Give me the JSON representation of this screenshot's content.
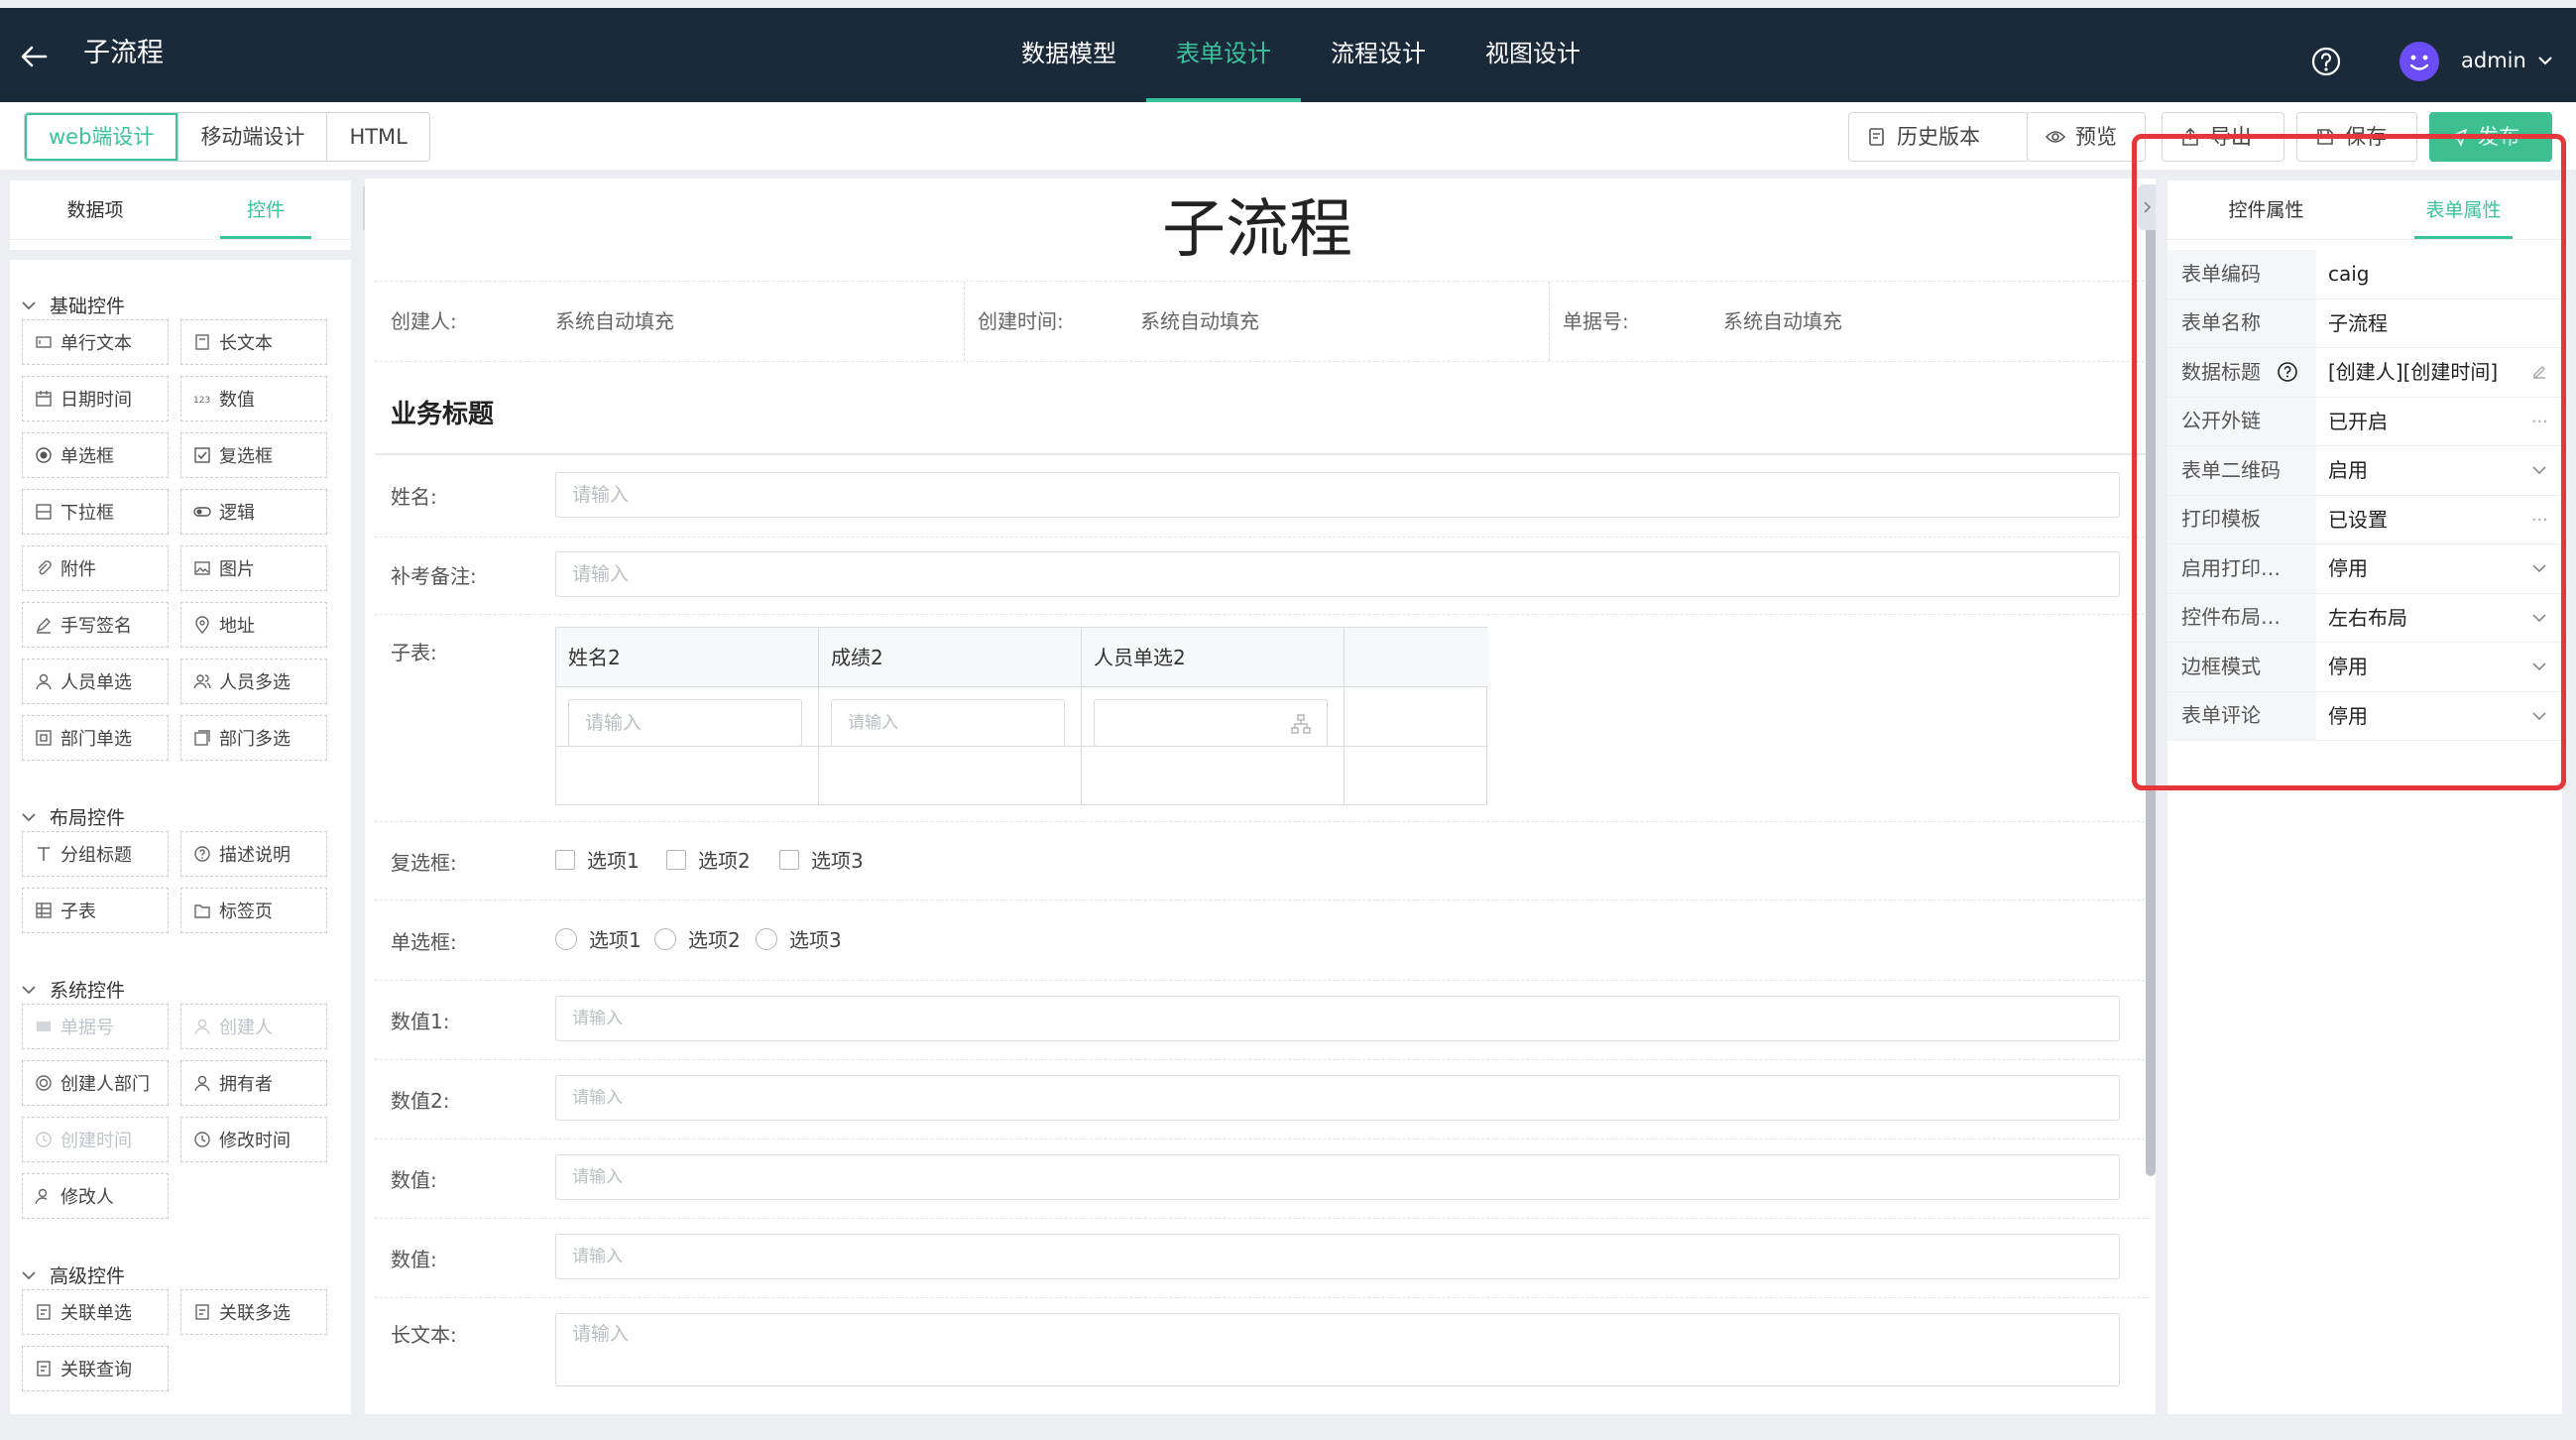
{
  "header": {
    "title": "子流程",
    "nav": [
      "数据模型",
      "表单设计",
      "流程设计",
      "视图设计"
    ],
    "active_nav": "表单设计",
    "user": "admin"
  },
  "toolbar": {
    "modes": [
      "web端设计",
      "移动端设计",
      "HTML"
    ],
    "history": "历史版本",
    "preview": "预览",
    "export": "导出",
    "save": "保存",
    "publish": "发布"
  },
  "left": {
    "tabs": [
      "数据项",
      "控件"
    ],
    "active_tab": "控件",
    "groups": {
      "basic": {
        "title": "基础控件",
        "items": [
          "单行文本",
          "长文本",
          "日期时间",
          "数值",
          "单选框",
          "复选框",
          "下拉框",
          "逻辑",
          "附件",
          "图片",
          "手写签名",
          "地址",
          "人员单选",
          "人员多选",
          "部门单选",
          "部门多选"
        ]
      },
      "layout": {
        "title": "布局控件",
        "items": [
          "分组标题",
          "描述说明",
          "子表",
          "标签页"
        ]
      },
      "system": {
        "title": "系统控件",
        "items": [
          "单据号",
          "创建人",
          "创建人部门",
          "拥有者",
          "创建时间",
          "修改时间",
          "修改人"
        ]
      },
      "advanced": {
        "title": "高级控件",
        "items": [
          "关联单选",
          "关联多选",
          "关联查询"
        ]
      }
    }
  },
  "form": {
    "title": "子流程",
    "sys_fields": [
      {
        "label": "创建人:",
        "value": "系统自动填充"
      },
      {
        "label": "创建时间:",
        "value": "系统自动填充"
      },
      {
        "label": "单据号:",
        "value": "系统自动填充"
      }
    ],
    "section_title": "业务标题",
    "placeholder": "请输入",
    "fields": {
      "name": "姓名:",
      "remark": "补考备注:",
      "subtable": "子表:",
      "checkbox": "复选框:",
      "radio": "单选框:",
      "num1": "数值1:",
      "num2": "数值2:",
      "num3": "数值:",
      "num4": "数值:",
      "longtext": "长文本:"
    },
    "subtable_columns": [
      "姓名2",
      "成绩2",
      "人员单选2"
    ],
    "options": [
      "选项1",
      "选项2",
      "选项3"
    ]
  },
  "right": {
    "tabs": [
      "控件属性",
      "表单属性"
    ],
    "active_tab": "表单属性",
    "props": [
      {
        "k": "表单编码",
        "v": "caig"
      },
      {
        "k": "表单名称",
        "v": "子流程"
      },
      {
        "k": "数据标题",
        "v": "[创建人][创建时间]"
      },
      {
        "k": "公开外链",
        "v": "已开启"
      },
      {
        "k": "表单二维码",
        "v": "启用"
      },
      {
        "k": "打印模板",
        "v": "已设置"
      },
      {
        "k": "启用打印…",
        "v": "停用"
      },
      {
        "k": "控件布局…",
        "v": "左右布局"
      },
      {
        "k": "边框模式",
        "v": "停用"
      },
      {
        "k": "表单评论",
        "v": "停用"
      }
    ]
  },
  "colors": {
    "accent": "#39c39a",
    "header_bg": "#1b2a3b",
    "highlight": "#e5373a",
    "avatar": "#6a4df5"
  }
}
